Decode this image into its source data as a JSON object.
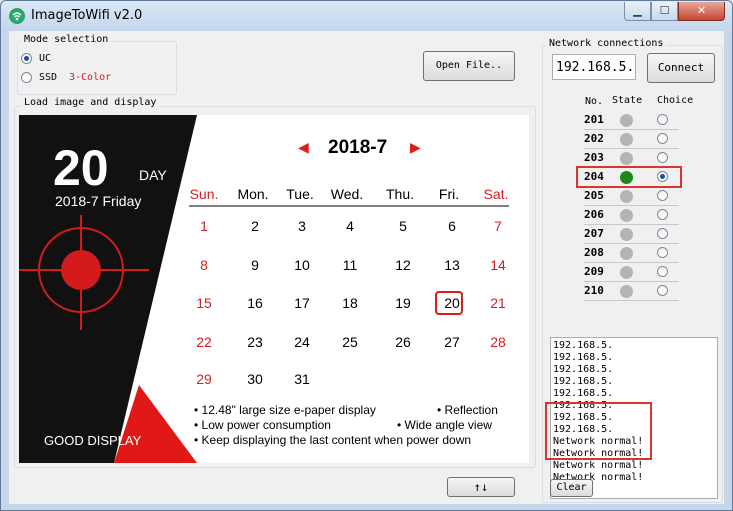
{
  "window": {
    "title": "ImageToWifi v2.0"
  },
  "mode": {
    "group_label": "Mode selection",
    "options": [
      {
        "label": "UC",
        "selected": true
      },
      {
        "label": "SSD",
        "selected": false,
        "extra": "3-Color"
      }
    ]
  },
  "open_file_label": "Open File..",
  "display_group_label": "Load image and display",
  "calendar": {
    "day_number": "20",
    "day_label": "DAY",
    "date_line": "2018-7 Friday",
    "month_title": "2018-7",
    "prev_arrow": "◀",
    "next_arrow": "▶",
    "weekdays": [
      "Sun.",
      "Mon.",
      "Tue.",
      "Wed.",
      "Thu.",
      "Fri.",
      "Sat."
    ],
    "weeks": [
      [
        "1",
        "2",
        "3",
        "4",
        "5",
        "6",
        "7"
      ],
      [
        "8",
        "9",
        "10",
        "11",
        "12",
        "13",
        "14"
      ],
      [
        "15",
        "16",
        "17",
        "18",
        "19",
        "20",
        "21"
      ],
      [
        "22",
        "23",
        "24",
        "25",
        "26",
        "27",
        "28"
      ],
      [
        "29",
        "30",
        "31",
        "",
        "",
        "",
        ""
      ]
    ],
    "today": "20",
    "brand": "GOOD DISPLAY",
    "features": [
      "• 12.48\"  large size e-paper display",
      "• Reflection",
      "• Low power consumption",
      "• Wide angle view",
      "• Keep displaying the last content when power down"
    ]
  },
  "swap_button_label": "↑↓",
  "network": {
    "group_label": "Network connections",
    "ip_value": "192.168.5.",
    "connect_label": "Connect",
    "headers": {
      "no": "No.",
      "state": "State",
      "choice": "Choice"
    },
    "rows": [
      {
        "no": "201",
        "connected": false,
        "chosen": false
      },
      {
        "no": "202",
        "connected": false,
        "chosen": false
      },
      {
        "no": "203",
        "connected": false,
        "chosen": false
      },
      {
        "no": "204",
        "connected": true,
        "chosen": true
      },
      {
        "no": "205",
        "connected": false,
        "chosen": false
      },
      {
        "no": "206",
        "connected": false,
        "chosen": false
      },
      {
        "no": "207",
        "connected": false,
        "chosen": false
      },
      {
        "no": "208",
        "connected": false,
        "chosen": false
      },
      {
        "no": "209",
        "connected": false,
        "chosen": false
      },
      {
        "no": "210",
        "connected": false,
        "chosen": false
      }
    ],
    "log": [
      "192.168.5.",
      "192.168.5.",
      "192.168.5.",
      "192.168.5.",
      "192.168.5.",
      "192.168.5.",
      "192.168.5.",
      "192.168.5.",
      "Network normal!",
      "Network normal!",
      "Network normal!",
      "Network normal!"
    ],
    "clear_label": "Clear"
  },
  "colors": {
    "calendar_red": "#d81e1e",
    "connected_green": "#1a8a1a",
    "highlight_red": "#d9352e"
  }
}
